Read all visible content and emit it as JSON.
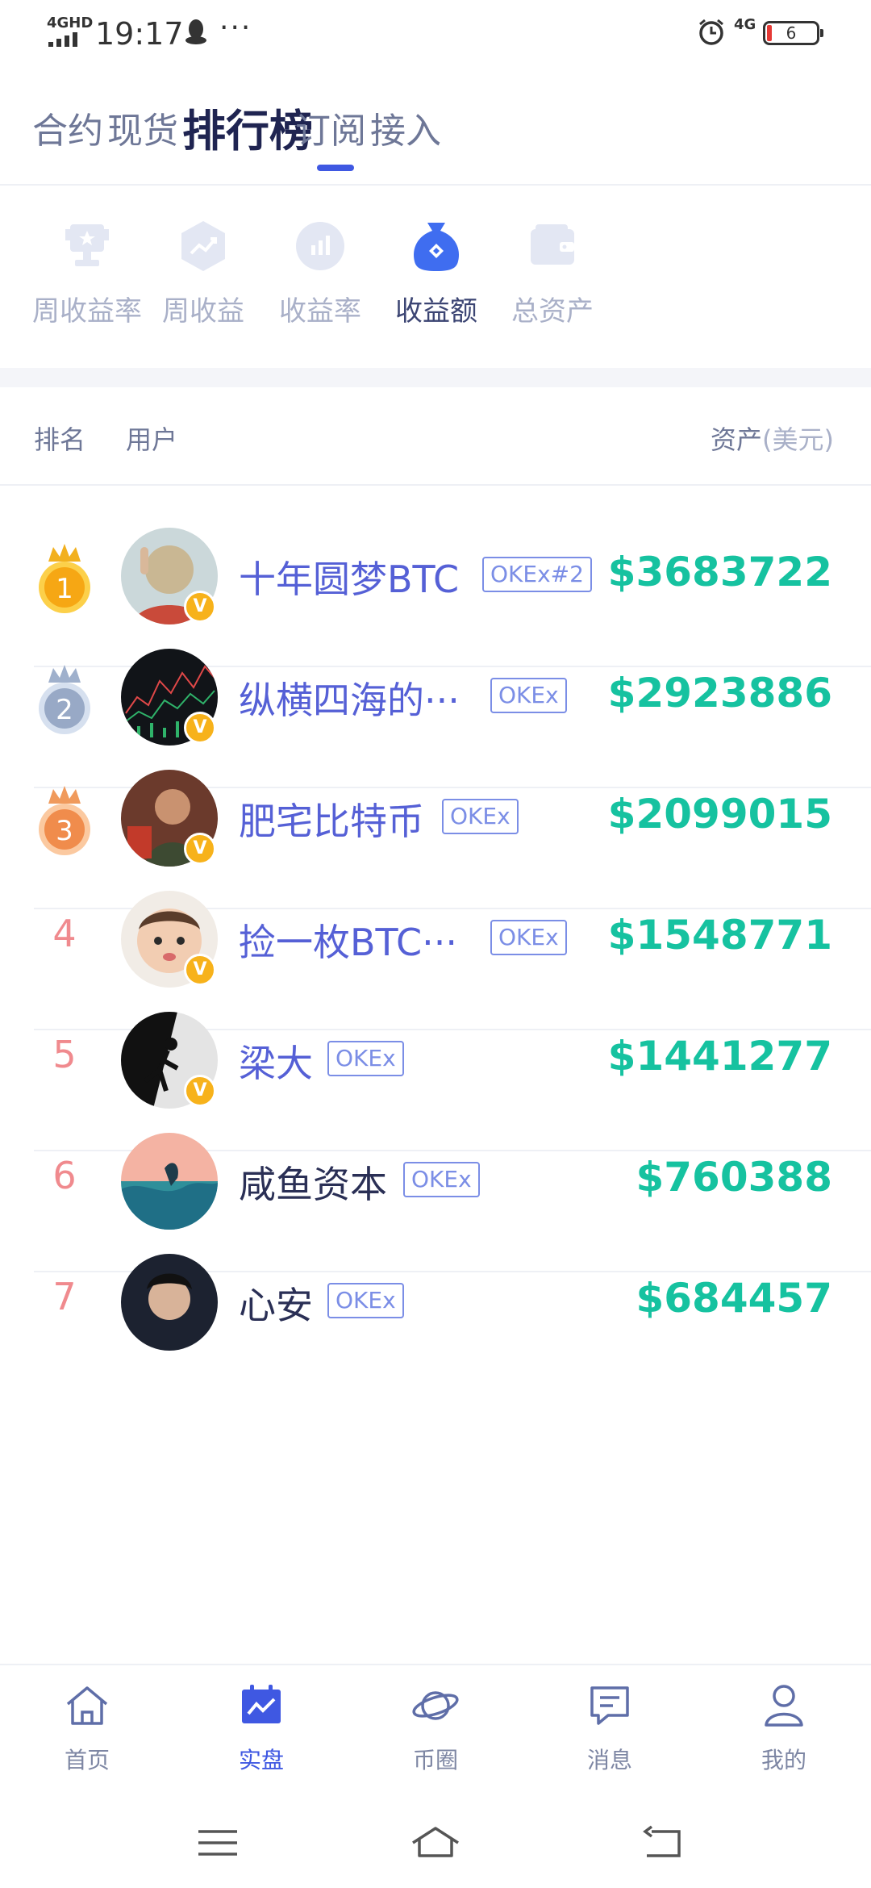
{
  "status_bar": {
    "network": "4GHD",
    "time": "19:17",
    "more": "···",
    "signal_right": "4G",
    "battery": "6"
  },
  "top_tabs": [
    {
      "label": "合约",
      "active": false
    },
    {
      "label": "现货",
      "active": false
    },
    {
      "label": "排行榜",
      "active": true
    },
    {
      "label": "订阅",
      "active": false
    },
    {
      "label": "接入",
      "active": false
    }
  ],
  "categories": [
    {
      "label": "周收益率",
      "icon": "trophy-icon",
      "active": false
    },
    {
      "label": "周收益",
      "icon": "trend-up-icon",
      "active": false
    },
    {
      "label": "收益率",
      "icon": "bar-chart-icon",
      "active": false
    },
    {
      "label": "收益额",
      "icon": "money-bag-icon",
      "active": true
    },
    {
      "label": "总资产",
      "icon": "wallet-icon",
      "active": false
    }
  ],
  "list_header": {
    "rank": "排名",
    "user": "用户",
    "asset": "资产",
    "asset_unit": "(美元)"
  },
  "rows": [
    {
      "rank": "1",
      "name": "十年圆梦BTC",
      "tag": "OKEx#2",
      "amount": "$3683722",
      "verified": true,
      "medal": "gold"
    },
    {
      "rank": "2",
      "name": "纵横四海的···",
      "tag": "OKEx",
      "amount": "$2923886",
      "verified": true,
      "medal": "silver"
    },
    {
      "rank": "3",
      "name": "肥宅比特币",
      "tag": "OKEx",
      "amount": "$2099015",
      "verified": true,
      "medal": "bronze"
    },
    {
      "rank": "4",
      "name": "捡一枚BTC···",
      "tag": "OKEx",
      "amount": "$1548771",
      "verified": true,
      "medal": ""
    },
    {
      "rank": "5",
      "name": "梁大",
      "tag": "OKEx",
      "amount": "$1441277",
      "verified": true,
      "medal": ""
    },
    {
      "rank": "6",
      "name": "咸鱼资本",
      "tag": "OKEx",
      "amount": "$760388",
      "verified": false,
      "medal": ""
    },
    {
      "rank": "7",
      "name": "心安",
      "tag": "OKEx",
      "amount": "$684457",
      "verified": false,
      "medal": ""
    }
  ],
  "bottom_nav": [
    {
      "label": "首页",
      "icon": "home-icon",
      "active": false
    },
    {
      "label": "实盘",
      "icon": "chart-icon",
      "active": true
    },
    {
      "label": "币圈",
      "icon": "planet-icon",
      "active": false
    },
    {
      "label": "消息",
      "icon": "message-icon",
      "active": false
    },
    {
      "label": "我的",
      "icon": "profile-icon",
      "active": false
    }
  ],
  "colors": {
    "accent": "#3f58e2",
    "amount": "#16c2a0",
    "username": "#5560d6",
    "rank_number": "#f08a8e",
    "verified_badge": "#f7b21b"
  }
}
